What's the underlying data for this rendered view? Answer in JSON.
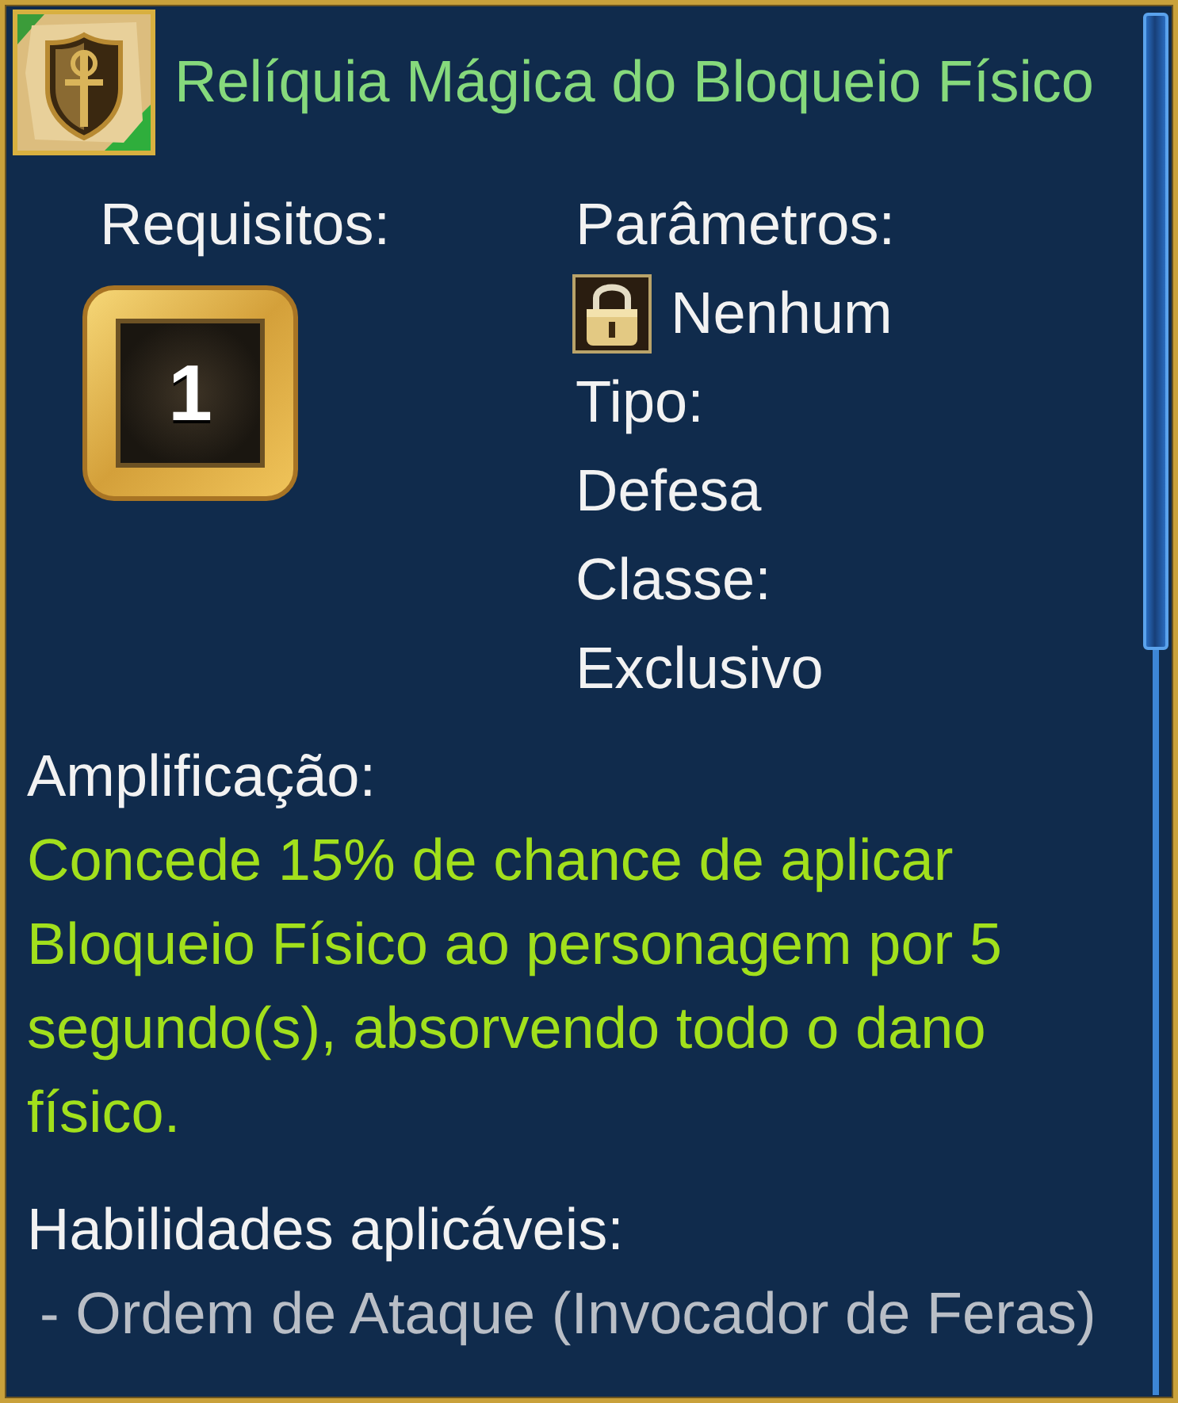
{
  "header": {
    "title": "Relíquia Mágica do Bloqueio Físico"
  },
  "requirements": {
    "label": "Requisitos:",
    "value": "1"
  },
  "parameters": {
    "label": "Parâmetros:",
    "value": "Nenhum"
  },
  "type": {
    "label": "Tipo:",
    "value": "Defesa"
  },
  "class": {
    "label": "Classe:",
    "value": "Exclusivo"
  },
  "amplification": {
    "label": "Amplificação:",
    "text": "Concede 15% de chance de aplicar Bloqueio Físico ao personagem por 5 segundo(s), absorvendo todo o dano físico."
  },
  "applicable_skills": {
    "label": "Habilidades aplicáveis:",
    "items": [
      "- Ordem de Ataque (Invocador de Feras)"
    ]
  }
}
